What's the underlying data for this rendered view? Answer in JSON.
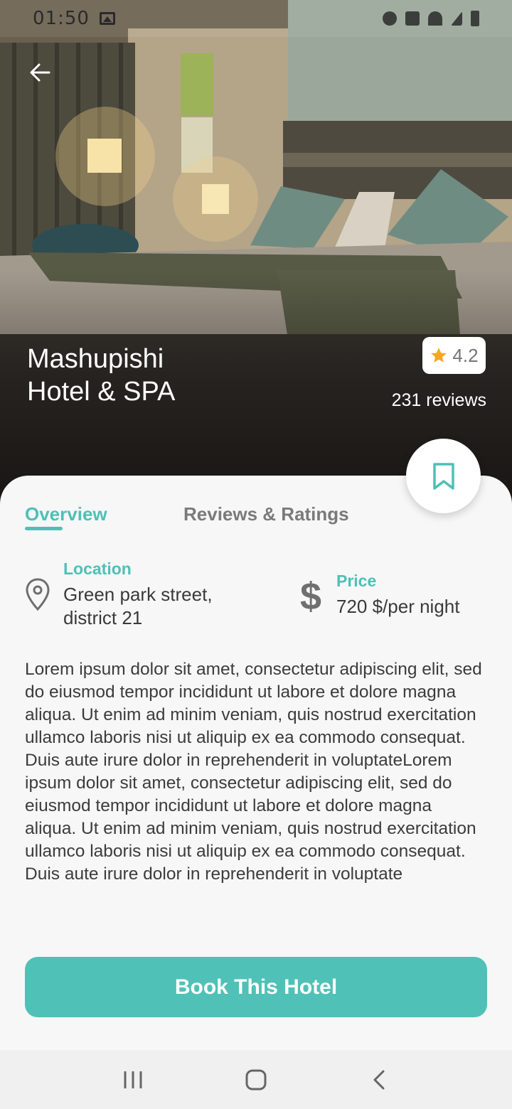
{
  "status_bar": {
    "time": "01:50",
    "left_icons": [
      "image-icon"
    ],
    "right_icons": [
      "alarm-icon",
      "mute-icon",
      "wifi-icon",
      "signal-icon",
      "battery-icon"
    ]
  },
  "header": {
    "back_icon": "arrow-left-icon",
    "hotel_name_line1": "Mashupishi",
    "hotel_name_line2": "Hotel & SPA",
    "rating": "4.2",
    "rating_icon": "star-icon",
    "reviews": "231 reviews",
    "bookmark_icon": "bookmark-icon"
  },
  "tabs": [
    {
      "label": "Overview",
      "active": true
    },
    {
      "label": "Reviews & Ratings",
      "active": false
    }
  ],
  "details": {
    "location_label": "Location",
    "location_line1": "Green park street,",
    "location_line2": "district 21",
    "price_label": "Price",
    "price_value": "720 $/per night"
  },
  "description": "Lorem ipsum dolor sit amet, consectetur adipiscing elit, sed do eiusmod tempor incididunt ut labore et dolore magna aliqua. Ut enim ad minim veniam, quis nostrud exercitation ullamco laboris nisi ut aliquip ex ea commodo consequat. Duis aute irure dolor in reprehenderit in voluptateLorem ipsum dolor sit amet, consectetur adipiscing elit, sed do eiusmod tempor incididunt ut labore et dolore magna aliqua. Ut enim ad minim veniam, quis nostrud exercitation ullamco laboris nisi ut aliquip ex ea commodo consequat. Duis aute irure dolor in reprehenderit in voluptate",
  "cta": {
    "label": "Book This Hotel"
  },
  "nav_bar": {
    "icons": [
      "recent-apps-icon",
      "home-icon",
      "back-icon"
    ]
  },
  "colors": {
    "accent": "#50c1b6",
    "star": "#f5a623",
    "text_dark": "#3a3a3a",
    "tab_inactive": "#7a7a7a"
  }
}
